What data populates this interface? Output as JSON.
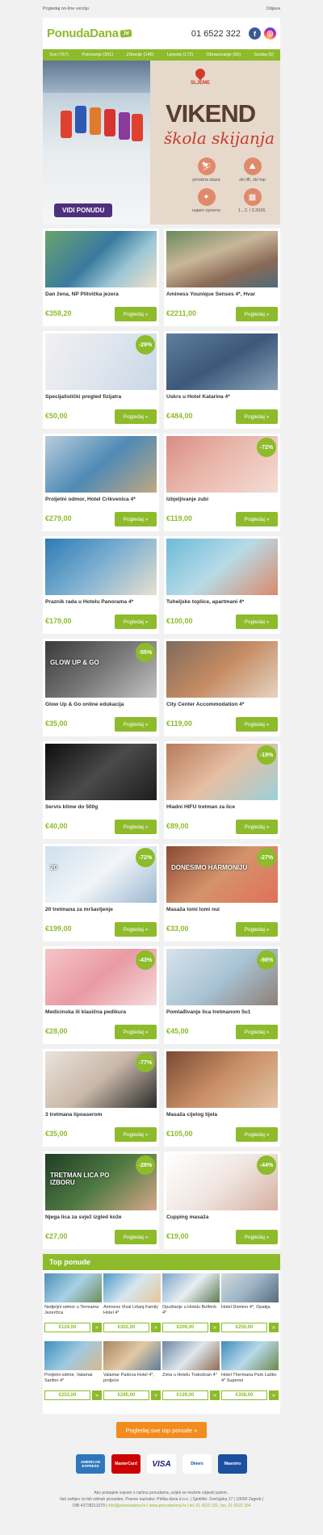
{
  "top": {
    "web_link": "Pogledaj on-line verziju",
    "unsubscribe": "Odjava"
  },
  "header": {
    "logo": "PonudaDana",
    "logo_suffix": ".hr",
    "phone": "01 6522 322"
  },
  "nav": [
    "Sve (767)",
    "Putovanja (361)",
    "Zdravlje (146)",
    "Ljepota (172)",
    "Obrazovanje (50)",
    "Gozba (5)"
  ],
  "hero": {
    "location": "SLJEME",
    "title": "VIKEND",
    "subtitle": "škola skijanja",
    "features": [
      "privatna staza",
      "ski lift, ski top",
      "najam opreme",
      "1., 2. i 3.2026."
    ],
    "cta": "VIDI PONUDU"
  },
  "cards": [
    {
      "title": "Dan žena, NP Plitvička jezera",
      "price": "€358,20",
      "button": "Pogledaj »",
      "badge": ""
    },
    {
      "title": "Aminess Younique Senses 4*, Hvar",
      "price": "€2211,00",
      "button": "Pogledaj »",
      "badge": ""
    },
    {
      "title": "Specijalistički pregled fizijatra",
      "price": "€50,00",
      "button": "Pogledaj »",
      "badge": "-29%"
    },
    {
      "title": "Uskrs u Hotel Katarina 4*",
      "price": "€484,00",
      "button": "Pogledaj »",
      "badge": ""
    },
    {
      "title": "Proljetni odmor, Hotel Crikvenica 4*",
      "price": "€279,00",
      "button": "Pogledaj »",
      "badge": ""
    },
    {
      "title": "Izbjeljivanje zubi",
      "price": "€119,00",
      "button": "Pogledaj »",
      "badge": "-72%"
    },
    {
      "title": "Praznik rada u Hotelu Panorama 4*",
      "price": "€179,00",
      "button": "Pogledaj »",
      "badge": ""
    },
    {
      "title": "Tuheljske toplice, apartmani 4*",
      "price": "€100,00",
      "button": "Pogledaj »",
      "badge": ""
    },
    {
      "title": "Glow Up & Go online edukacija",
      "price": "€35,00",
      "button": "Pogledaj »",
      "badge": "-55%"
    },
    {
      "title": "City Center Accommodation 4*",
      "price": "€119,00",
      "button": "Pogledaj »",
      "badge": ""
    },
    {
      "title": "Servis klime do 500g",
      "price": "€40,00",
      "button": "Pogledaj »",
      "badge": ""
    },
    {
      "title": "Hladni HIFU tretman za lice",
      "price": "€89,00",
      "button": "Pogledaj »",
      "badge": "-19%"
    },
    {
      "title": "20 tretmana za mršavljenje",
      "price": "€199,00",
      "button": "Pogledaj »",
      "badge": "-72%"
    },
    {
      "title": "Masaža lomi lomi nui",
      "price": "€33,00",
      "button": "Pogledaj »",
      "badge": "-27%"
    },
    {
      "title": "Medicinska ili klasična pedikura",
      "price": "€28,00",
      "button": "Pogledaj »",
      "badge": "-43%"
    },
    {
      "title": "Pomlađivanje lica tretmanom 5u1",
      "price": "€45,00",
      "button": "Pogledaj »",
      "badge": "-98%"
    },
    {
      "title": "3 tretmana lipoaserom",
      "price": "€35,00",
      "button": "Pogledaj »",
      "badge": "-77%"
    },
    {
      "title": "Masaža cijelog tijela",
      "price": "€105,00",
      "button": "Pogledaj »",
      "badge": ""
    },
    {
      "title": "Njega lica za svjež izgled kože",
      "price": "€27,00",
      "button": "Pogledaj »",
      "badge": "-28%"
    },
    {
      "title": "Cupping masaža",
      "price": "€19,00",
      "button": "Pogledaj »",
      "badge": "-44%"
    }
  ],
  "card_images": {
    "overlay_1": "TRETMAN LICA PO IZBORU",
    "overlay_2": "GLOW UP & GO",
    "overlay_3": "DONESIMO HARMONIJU",
    "overlay_4": "20"
  },
  "top_offers": {
    "heading": "Top ponude",
    "items": [
      {
        "title": "Nedjeljni odmor u Termama Jezerčica",
        "price": "€124,00"
      },
      {
        "title": "Aminess Vival Lišanj Family Hotel 4*",
        "price": "€302,00"
      },
      {
        "title": "Opuštanje u Hotelu Bolfenk 4*",
        "price": "€209,00"
      },
      {
        "title": "Hotel Domino 4*, Opatija",
        "price": "€250,00"
      },
      {
        "title": "Proljetni odmor, Valamar Sanfior 4*",
        "price": "€253,00"
      },
      {
        "title": "Valamar Padova Hotel 4*, proljeće",
        "price": "€285,00"
      },
      {
        "title": "Zima u Hotelu Trakošćan 4*",
        "price": "€129,00"
      },
      {
        "title": "Hotel Thermana Park Laško 4* Superior",
        "price": "€358,00"
      }
    ],
    "button": "»",
    "all_button": "Pogledaj sve top ponude »"
  },
  "payments": [
    "AMERICAN EXPRESS",
    "MasterCard",
    "VISA",
    "Diners",
    "Maestro"
  ],
  "footer": {
    "line1": "Ako postajete svjesni o načinu ponudama, uvijek se možete odjaviti putem .",
    "line2": "Vaš zahtjev će biti odmah proveden. Pravne naznake: Prilika dana d.o.o. | Sjedište: Zvečajska 17 | 10000 Zagreb |",
    "line3_a": "OIB 43728211079 |",
    "line3_b": "info@ponudadana.hr | www.ponudadana.hr | tel. 01 6522 322, fax. 01 6522 304"
  }
}
